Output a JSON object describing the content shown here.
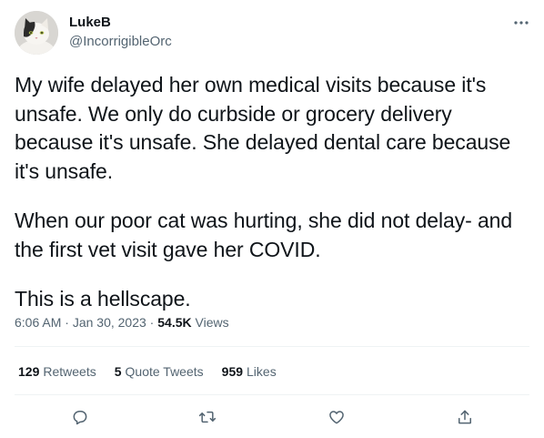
{
  "author": {
    "name": "LukeB",
    "handle": "@IncorrigibleOrc",
    "avatar_icon": "cat-avatar"
  },
  "tweet": {
    "paragraphs": [
      [
        "My wife delayed her own medical visits because it's",
        "unsafe. We only do curbside or grocery delivery",
        "because it's unsafe. She delayed dental care because",
        "it's unsafe."
      ],
      [
        "When our poor cat was hurting, she did not delay- and",
        "the first vet visit gave her COVID."
      ],
      [
        "This is a hellscape."
      ]
    ]
  },
  "meta": {
    "time": "6:06 AM",
    "separator": " · ",
    "date": "Jan 30, 2023",
    "views_count": "54.5K",
    "views_label": " Views"
  },
  "stats": {
    "retweets_count": "129",
    "retweets_label": "Retweets",
    "quotes_count": "5",
    "quotes_label": "Quote Tweets",
    "likes_count": "959",
    "likes_label": "Likes"
  },
  "icons": {
    "more": "more-icon",
    "reply": "reply-icon",
    "retweet": "retweet-icon",
    "like": "like-icon",
    "share": "share-icon"
  },
  "colors": {
    "text_primary": "#0f1419",
    "text_secondary": "#536471",
    "divider": "#eff3f4"
  }
}
